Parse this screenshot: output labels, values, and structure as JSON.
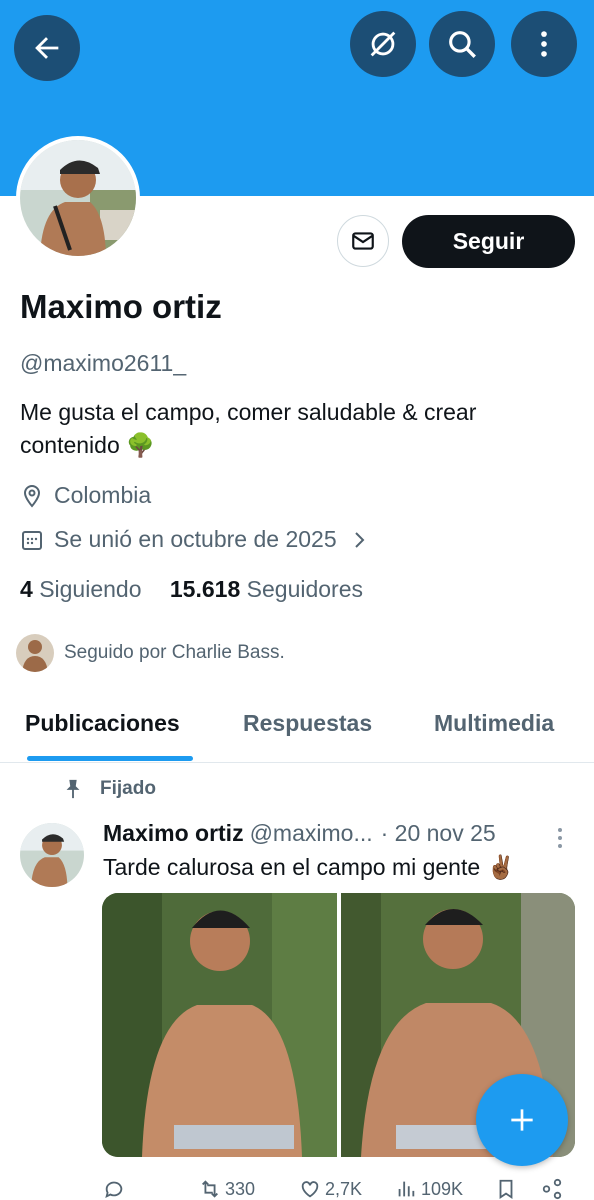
{
  "profile": {
    "follow_label": "Seguir",
    "name": "Maximo ortiz",
    "handle": "@maximo2611_",
    "bio": "Me gusta el campo, comer saludable & crear contenido 🌳",
    "location": "Colombia",
    "joined": "Se unió en octubre de 2025",
    "following_count": "4",
    "following_label": "Siguiendo",
    "followers_count": "15.618",
    "followers_label": "Seguidores",
    "followed_by": "Seguido por Charlie Bass."
  },
  "tabs": [
    "Publicaciones",
    "Respuestas",
    "Multimedia"
  ],
  "post": {
    "pinned_label": "Fijado",
    "author": "Maximo ortiz",
    "handle": "@maximo...",
    "date": "· 20 nov 25",
    "text": "Tarde calurosa en el campo mi gente ✌🏾",
    "reposts": "330",
    "likes": "2,7K",
    "views": "109K"
  },
  "icons": [
    "back-arrow-icon",
    "eye-off-icon",
    "search-icon",
    "more-vertical-icon",
    "mail-icon",
    "location-pin-icon",
    "calendar-icon",
    "chevron-right-icon",
    "pin-icon",
    "reply-icon",
    "repost-icon",
    "like-icon",
    "views-icon",
    "bookmark-icon",
    "share-icon",
    "plus-icon"
  ],
  "colors": {
    "accent": "#1d9bf0",
    "dark": "#0f1419",
    "muted": "#536471"
  }
}
